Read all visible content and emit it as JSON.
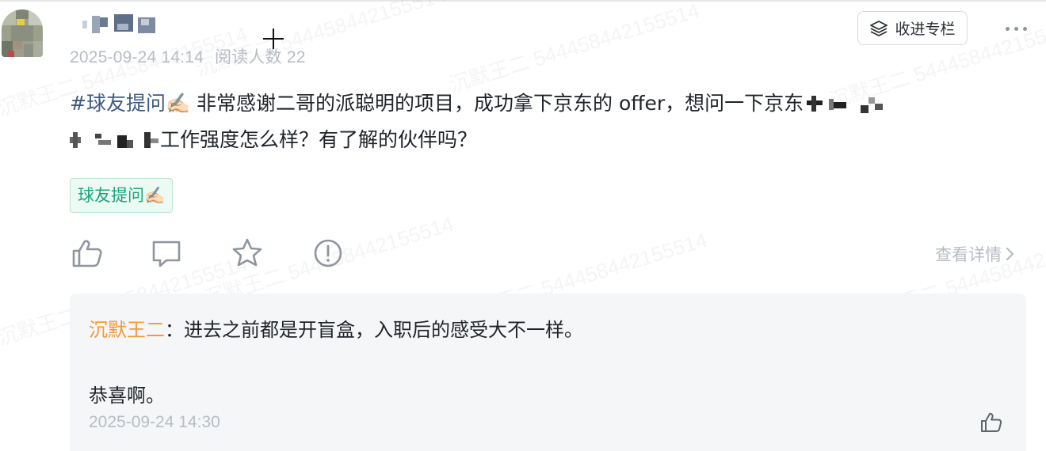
{
  "post": {
    "author_name": "",
    "date": "2025-09-24 14:14",
    "read_count_label": "阅读人数 22",
    "collect_button_label": "收进专栏",
    "hashtag": "#球友提问✍🏻",
    "body_part1": "  非常感谢二哥的派聪明的项目，成功拿下京东的 offer，想问一下京东",
    "body_part2": "工作强度怎么样？有了解的伙伴吗？",
    "tag_chip": "球友提问✍🏻",
    "details_link": "查看详情"
  },
  "actions": [
    {
      "name": "like-icon"
    },
    {
      "name": "comment-icon"
    },
    {
      "name": "star-icon"
    },
    {
      "name": "report-icon"
    }
  ],
  "comment": {
    "author": "沉默王二",
    "separator": "：",
    "text": "进去之前都是开盲盒，入职后的感受大不一样。",
    "reply": "恭喜啊。",
    "time": "2025-09-24 14:30"
  },
  "watermark": {
    "text": "沉默王二 544458442155514"
  },
  "colors": {
    "hashtag": "#3d5a80",
    "tag_text": "#1aa57c",
    "tag_bg": "#ecfaf4",
    "comment_author": "#f29a37",
    "muted": "#b7bcc4",
    "comment_bg": "#f5f6f7"
  }
}
